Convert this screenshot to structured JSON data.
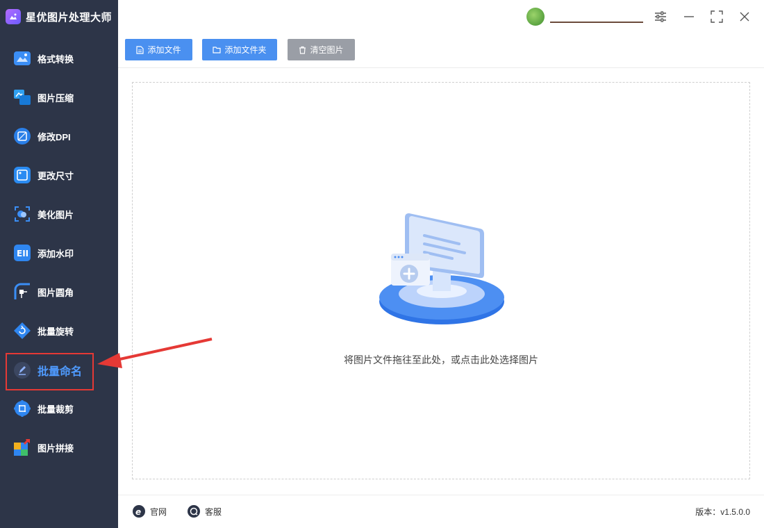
{
  "app": {
    "title": "星优图片处理大师"
  },
  "user": {
    "name": "",
    "avatar": "avatar"
  },
  "window_controls": [
    "settings-icon",
    "minimize-icon",
    "maximize-icon",
    "close-icon"
  ],
  "sidebar": {
    "items": [
      {
        "label": "格式转换",
        "icon": "format-convert-icon"
      },
      {
        "label": "图片压缩",
        "icon": "compress-icon"
      },
      {
        "label": "修改DPI",
        "icon": "dpi-icon"
      },
      {
        "label": "更改尺寸",
        "icon": "resize-icon"
      },
      {
        "label": "美化图片",
        "icon": "beautify-icon"
      },
      {
        "label": "添加水印",
        "icon": "watermark-icon"
      },
      {
        "label": "图片圆角",
        "icon": "round-corner-icon"
      },
      {
        "label": "批量旋转",
        "icon": "rotate-icon"
      },
      {
        "label": "批量命名",
        "icon": "rename-icon",
        "active": true
      },
      {
        "label": "批量裁剪",
        "icon": "crop-icon"
      },
      {
        "label": "图片拼接",
        "icon": "stitch-icon"
      }
    ]
  },
  "toolbar": {
    "add_file": "添加文件",
    "add_folder": "添加文件夹",
    "clear_images": "清空图片"
  },
  "dropzone": {
    "hint": "将图片文件拖往至此处，或点击此处选择图片"
  },
  "footer": {
    "website": "官网",
    "support": "客服",
    "version_label": "版本：",
    "version": "v1.5.0.0"
  },
  "colors": {
    "sidebar_bg": "#2d3548",
    "accent": "#4a90f0",
    "highlight": "#e53935"
  }
}
